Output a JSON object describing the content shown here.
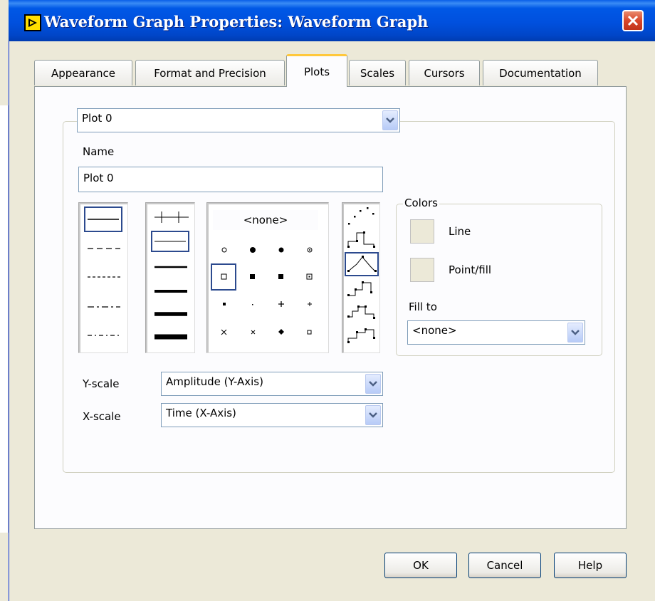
{
  "window": {
    "title": "Waveform Graph Properties: Waveform Graph"
  },
  "tabs": [
    {
      "label": "Appearance"
    },
    {
      "label": "Format and Precision"
    },
    {
      "label": "Plots"
    },
    {
      "label": "Scales"
    },
    {
      "label": "Cursors"
    },
    {
      "label": "Documentation"
    }
  ],
  "active_tab": "Plots",
  "plot_selector": {
    "value": "Plot 0"
  },
  "name_field": {
    "label": "Name",
    "value": "Plot 0"
  },
  "point_style_list": {
    "header": "<none>"
  },
  "colors": {
    "group_label": "Colors",
    "line_label": "Line",
    "point_fill_label": "Point/fill",
    "fill_to_label": "Fill to",
    "fill_to_value": "<none>"
  },
  "y_scale": {
    "label": "Y-scale",
    "value": "Amplitude (Y-Axis)"
  },
  "x_scale": {
    "label": "X-scale",
    "value": "Time (X-Axis)"
  },
  "buttons": {
    "ok": "OK",
    "cancel": "Cancel",
    "help": "Help"
  },
  "colors_theme": {
    "title_bar": "#0054e3",
    "close_button": "#d8462a",
    "active_tab_accent": "#ffc83c",
    "dialog_bg": "#ece9d8"
  }
}
